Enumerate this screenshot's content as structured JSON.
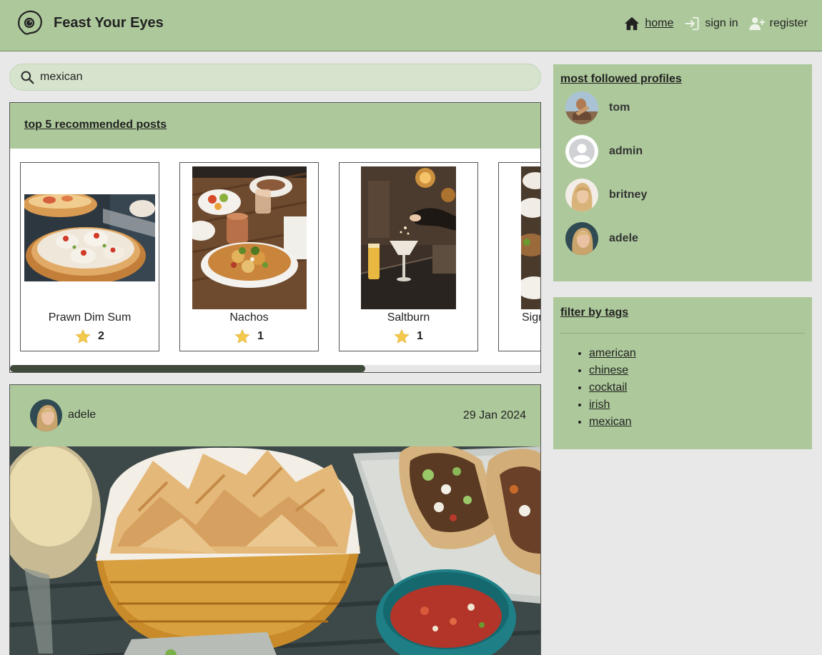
{
  "header": {
    "brand": "Feast Your Eyes",
    "nav": [
      {
        "label": "home",
        "icon": "home-icon",
        "active": true
      },
      {
        "label": "sign in",
        "icon": "sign-in-icon"
      },
      {
        "label": "register",
        "icon": "register-icon"
      }
    ]
  },
  "search": {
    "value": "mexican",
    "icon": "search-icon"
  },
  "recommended": {
    "title": "top 5 recommended posts",
    "items": [
      {
        "name": "Prawn Dim Sum",
        "rating": "2"
      },
      {
        "name": "Nachos",
        "rating": "1"
      },
      {
        "name": "Saltburn",
        "rating": "1"
      },
      {
        "name": "Sign"
      }
    ],
    "scroll_position": 0.67
  },
  "post": {
    "user": "adele",
    "date": "29 Jan 2024"
  },
  "profiles": {
    "title": "most followed profiles",
    "items": [
      {
        "name": "tom"
      },
      {
        "name": "admin"
      },
      {
        "name": "britney"
      },
      {
        "name": "adele"
      }
    ]
  },
  "tags": {
    "title": "filter by tags",
    "items": [
      "american",
      "chinese",
      "cocktail",
      "irish",
      "mexican"
    ]
  },
  "colors": {
    "header_bg": "#adc99b",
    "page_bg": "#e8e8e8",
    "search_bg": "#d6e4cd",
    "star": "#f2c94c",
    "scrollbar": "#3f4a3a"
  }
}
